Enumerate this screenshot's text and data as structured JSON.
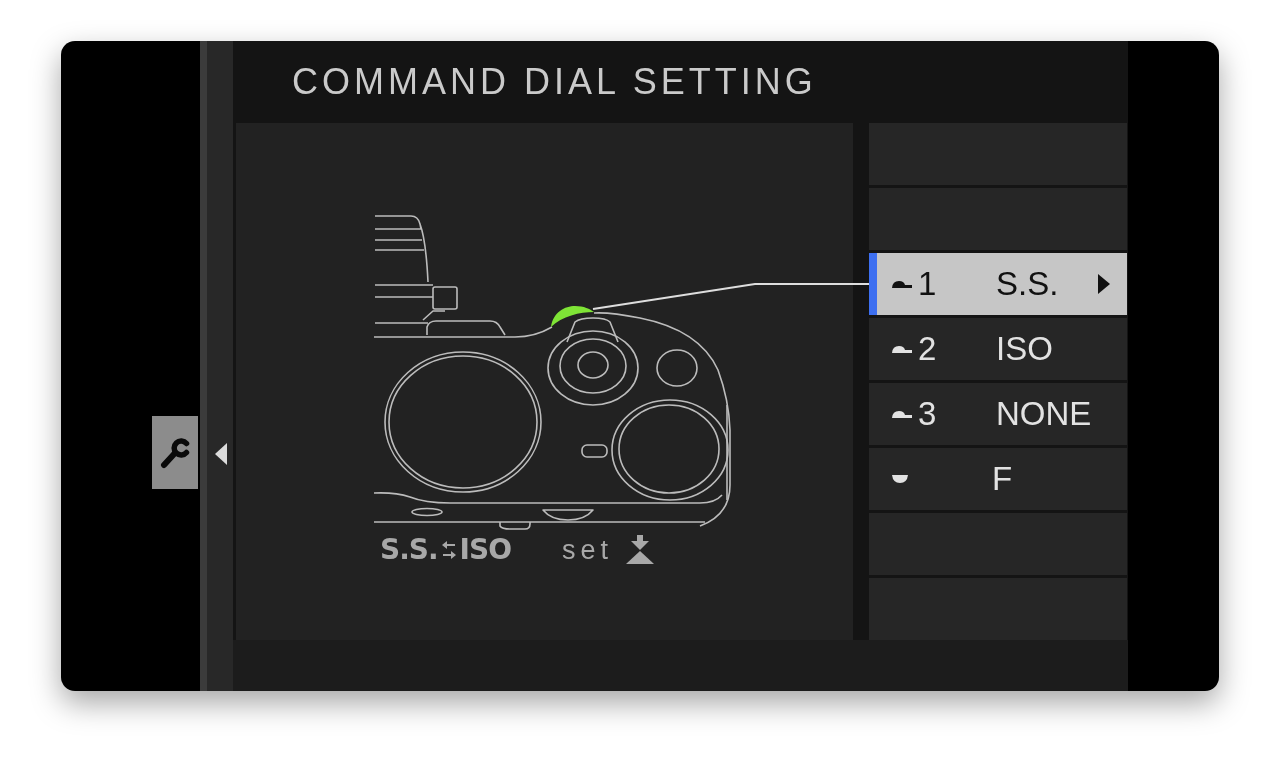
{
  "title": "COMMAND DIAL SETTING",
  "side_tabs": [
    {
      "selected": true
    }
  ],
  "caption": {
    "from": "S.S.",
    "to": "ISO",
    "action": "set"
  },
  "options": [
    {
      "kind": "blank"
    },
    {
      "kind": "blank"
    },
    {
      "kind": "upper",
      "number": "1",
      "value": "S.S.",
      "selected": true
    },
    {
      "kind": "upper",
      "number": "2",
      "value": "ISO",
      "selected": false
    },
    {
      "kind": "upper",
      "number": "3",
      "value": "NONE",
      "selected": false
    },
    {
      "kind": "lower",
      "value": "F",
      "selected": false
    },
    {
      "kind": "blank"
    },
    {
      "kind": "blank"
    }
  ]
}
